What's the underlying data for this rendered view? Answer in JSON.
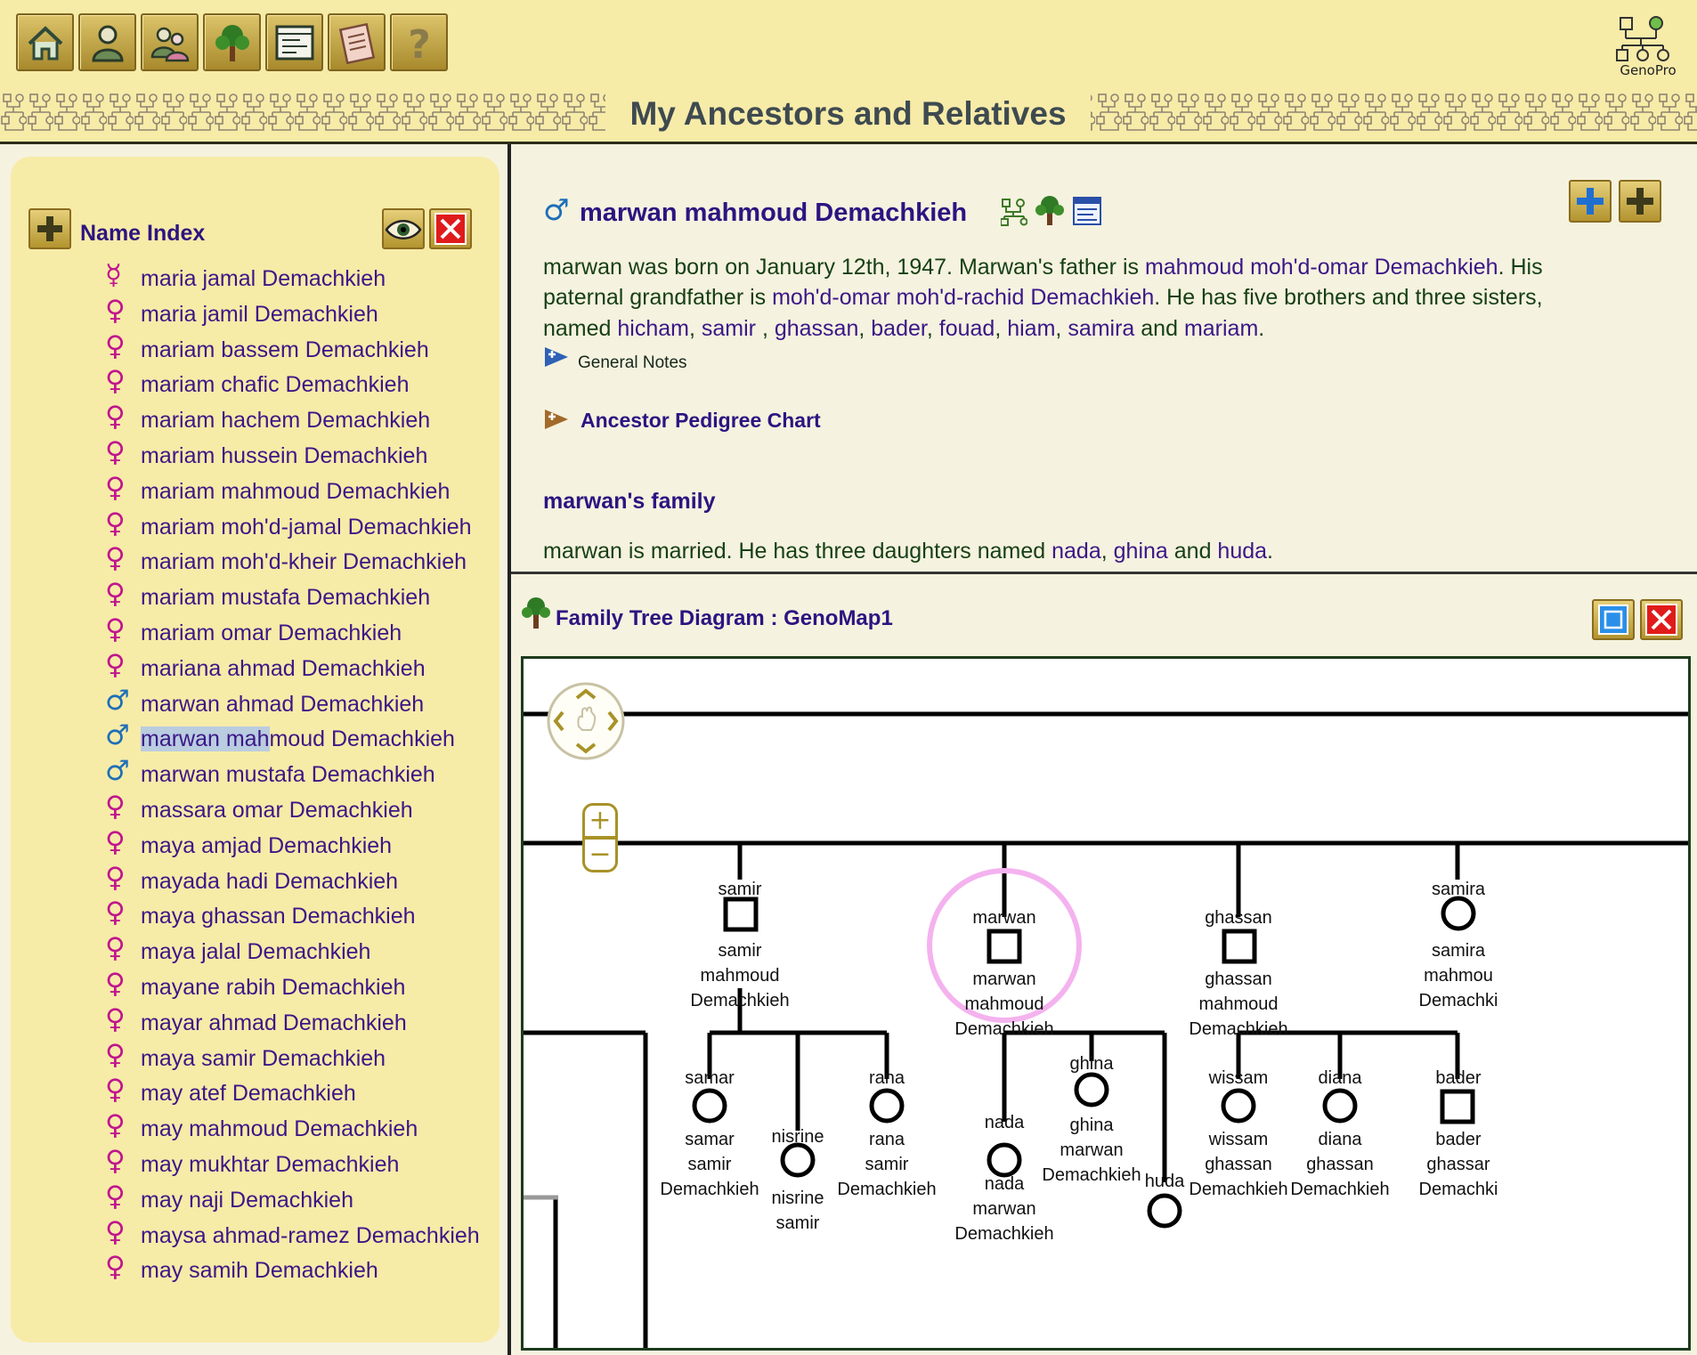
{
  "header": {
    "title": "My Ancestors and Relatives",
    "brand": "GenoPro",
    "toolbar": [
      {
        "name": "home-icon"
      },
      {
        "name": "person-icon"
      },
      {
        "name": "family-icon"
      },
      {
        "name": "tree-icon"
      },
      {
        "name": "report-icon"
      },
      {
        "name": "notes-icon"
      },
      {
        "name": "help-icon"
      }
    ]
  },
  "name_index": {
    "title": "Name Index",
    "items": [
      {
        "gender": "f",
        "symbol": "☿",
        "name": "maria jamal Demachkieh"
      },
      {
        "gender": "f",
        "symbol": "♀",
        "name": "maria jamil Demachkieh"
      },
      {
        "gender": "f",
        "symbol": "♀",
        "name": "mariam bassem Demachkieh"
      },
      {
        "gender": "f",
        "symbol": "♀",
        "name": "mariam chafic Demachkieh"
      },
      {
        "gender": "f",
        "symbol": "♀",
        "name": "mariam hachem Demachkieh"
      },
      {
        "gender": "f",
        "symbol": "♀",
        "name": "mariam hussein Demachkieh"
      },
      {
        "gender": "f",
        "symbol": "♀",
        "name": "mariam mahmoud Demachkieh"
      },
      {
        "gender": "f",
        "symbol": "♀",
        "name": "mariam moh'd-jamal Demachkieh"
      },
      {
        "gender": "f",
        "symbol": "♀",
        "name": "mariam moh'd-kheir Demachkieh"
      },
      {
        "gender": "f",
        "symbol": "♀",
        "name": "mariam mustafa Demachkieh"
      },
      {
        "gender": "f",
        "symbol": "♀",
        "name": "mariam omar Demachkieh"
      },
      {
        "gender": "f",
        "symbol": "♀",
        "name": "mariana ahmad Demachkieh"
      },
      {
        "gender": "m",
        "symbol": "♂",
        "name": "marwan ahmad Demachkieh"
      },
      {
        "gender": "m",
        "symbol": "♂",
        "name": "marwan mahmoud Demachkieh",
        "selected": true,
        "highlight": "marwan mah",
        "rest": "moud Demachkieh"
      },
      {
        "gender": "m",
        "symbol": "♂",
        "name": "marwan mustafa Demachkieh"
      },
      {
        "gender": "f",
        "symbol": "♀",
        "name": "massara omar Demachkieh"
      },
      {
        "gender": "f",
        "symbol": "♀",
        "name": "maya amjad Demachkieh"
      },
      {
        "gender": "f",
        "symbol": "♀",
        "name": "mayada hadi Demachkieh"
      },
      {
        "gender": "f",
        "symbol": "♀",
        "name": "maya ghassan Demachkieh"
      },
      {
        "gender": "f",
        "symbol": "♀",
        "name": "maya jalal Demachkieh"
      },
      {
        "gender": "f",
        "symbol": "♀",
        "name": "mayane rabih Demachkieh"
      },
      {
        "gender": "f",
        "symbol": "♀",
        "name": "mayar ahmad Demachkieh"
      },
      {
        "gender": "f",
        "symbol": "♀",
        "name": "maya samir Demachkieh"
      },
      {
        "gender": "f",
        "symbol": "♀",
        "name": "may atef Demachkieh"
      },
      {
        "gender": "f",
        "symbol": "♀",
        "name": "may mahmoud Demachkieh"
      },
      {
        "gender": "f",
        "symbol": "♀",
        "name": "may mukhtar Demachkieh"
      },
      {
        "gender": "f",
        "symbol": "♀",
        "name": "may naji Demachkieh"
      },
      {
        "gender": "f",
        "symbol": "♀",
        "name": "maysa ahmad-ramez Demachkieh"
      },
      {
        "gender": "f",
        "symbol": "♀",
        "name": "may samih Demachkieh"
      }
    ]
  },
  "person": {
    "symbol": "♂",
    "name": "marwan mahmoud Demachkieh",
    "bio_line1": {
      "a": "marwan was born on January 12th, 1947.  Marwan's father is ",
      "father": "mahmoud moh'd-omar Demachkieh",
      "b": ".  His"
    },
    "bio_line2": {
      "a": "paternal grandfather is ",
      "grandfather": "moh'd-omar moh'd-rachid Demachkieh",
      "b": ". He has five brothers and three sisters,"
    },
    "bio_line3": {
      "a": "named ",
      "s1": "hicham",
      "s2": "samir",
      "s3": "ghassan",
      "s4": "bader",
      "s5": "fouad",
      "s6": "hiam",
      "s7": "samira",
      "and": " and ",
      "s8": "mariam",
      "end": "."
    },
    "general_notes": "General Notes",
    "pedigree": "Ancestor Pedigree Chart",
    "family_heading": "marwan's family",
    "family_line": {
      "a": "marwan is married.  He has three daughters named ",
      "d1": "nada",
      "d2": "ghina",
      "and": " and ",
      "d3": "huda",
      "end": "."
    }
  },
  "tree": {
    "title": "Family Tree Diagram : GenoMap1",
    "people": [
      {
        "nick": "samir",
        "shape": "square",
        "l1": "samir",
        "l2": "mahmoud",
        "l3": "Demachkieh"
      },
      {
        "nick": "marwan",
        "shape": "square",
        "l1": "marwan",
        "l2": "mahmoud",
        "l3": "Demachkieh",
        "selected": true
      },
      {
        "nick": "ghassan",
        "shape": "square",
        "l1": "ghassan",
        "l2": "mahmoud",
        "l3": "Demachkieh"
      },
      {
        "nick": "samira",
        "shape": "circle",
        "l1": "samira",
        "l2": "mahmou",
        "l3": "Demachki"
      },
      {
        "nick": "samar",
        "shape": "circle",
        "l1": "samar",
        "l2": "samir",
        "l3": "Demachkieh"
      },
      {
        "nick": "nisrine",
        "shape": "circle",
        "l1": "nisrine",
        "l2": "samir",
        "l3": ""
      },
      {
        "nick": "rana",
        "shape": "circle",
        "l1": "rana",
        "l2": "samir",
        "l3": "Demachkieh"
      },
      {
        "nick": "nada",
        "shape": "circle",
        "l1": "nada",
        "l2": "marwan",
        "l3": "Demachkieh"
      },
      {
        "nick": "ghina",
        "shape": "circle",
        "l1": "ghina",
        "l2": "marwan",
        "l3": "Demachkieh"
      },
      {
        "nick": "huda",
        "shape": "circle",
        "l1": "",
        "l2": "",
        "l3": ""
      },
      {
        "nick": "wissam",
        "shape": "circle",
        "l1": "wissam",
        "l2": "ghassan",
        "l3": "Demachkieh"
      },
      {
        "nick": "diana",
        "shape": "circle",
        "l1": "diana",
        "l2": "ghassan",
        "l3": "Demachkieh"
      },
      {
        "nick": "bader",
        "shape": "square",
        "l1": "bader",
        "l2": "ghassar",
        "l3": "Demachki"
      }
    ]
  },
  "colors": {
    "header_bg": "#f7eba8",
    "link": "#3b1787",
    "text": "#163f14",
    "female": "#c0158e",
    "male": "#1d6fb7",
    "selection_ring": "#f4b2ee"
  }
}
